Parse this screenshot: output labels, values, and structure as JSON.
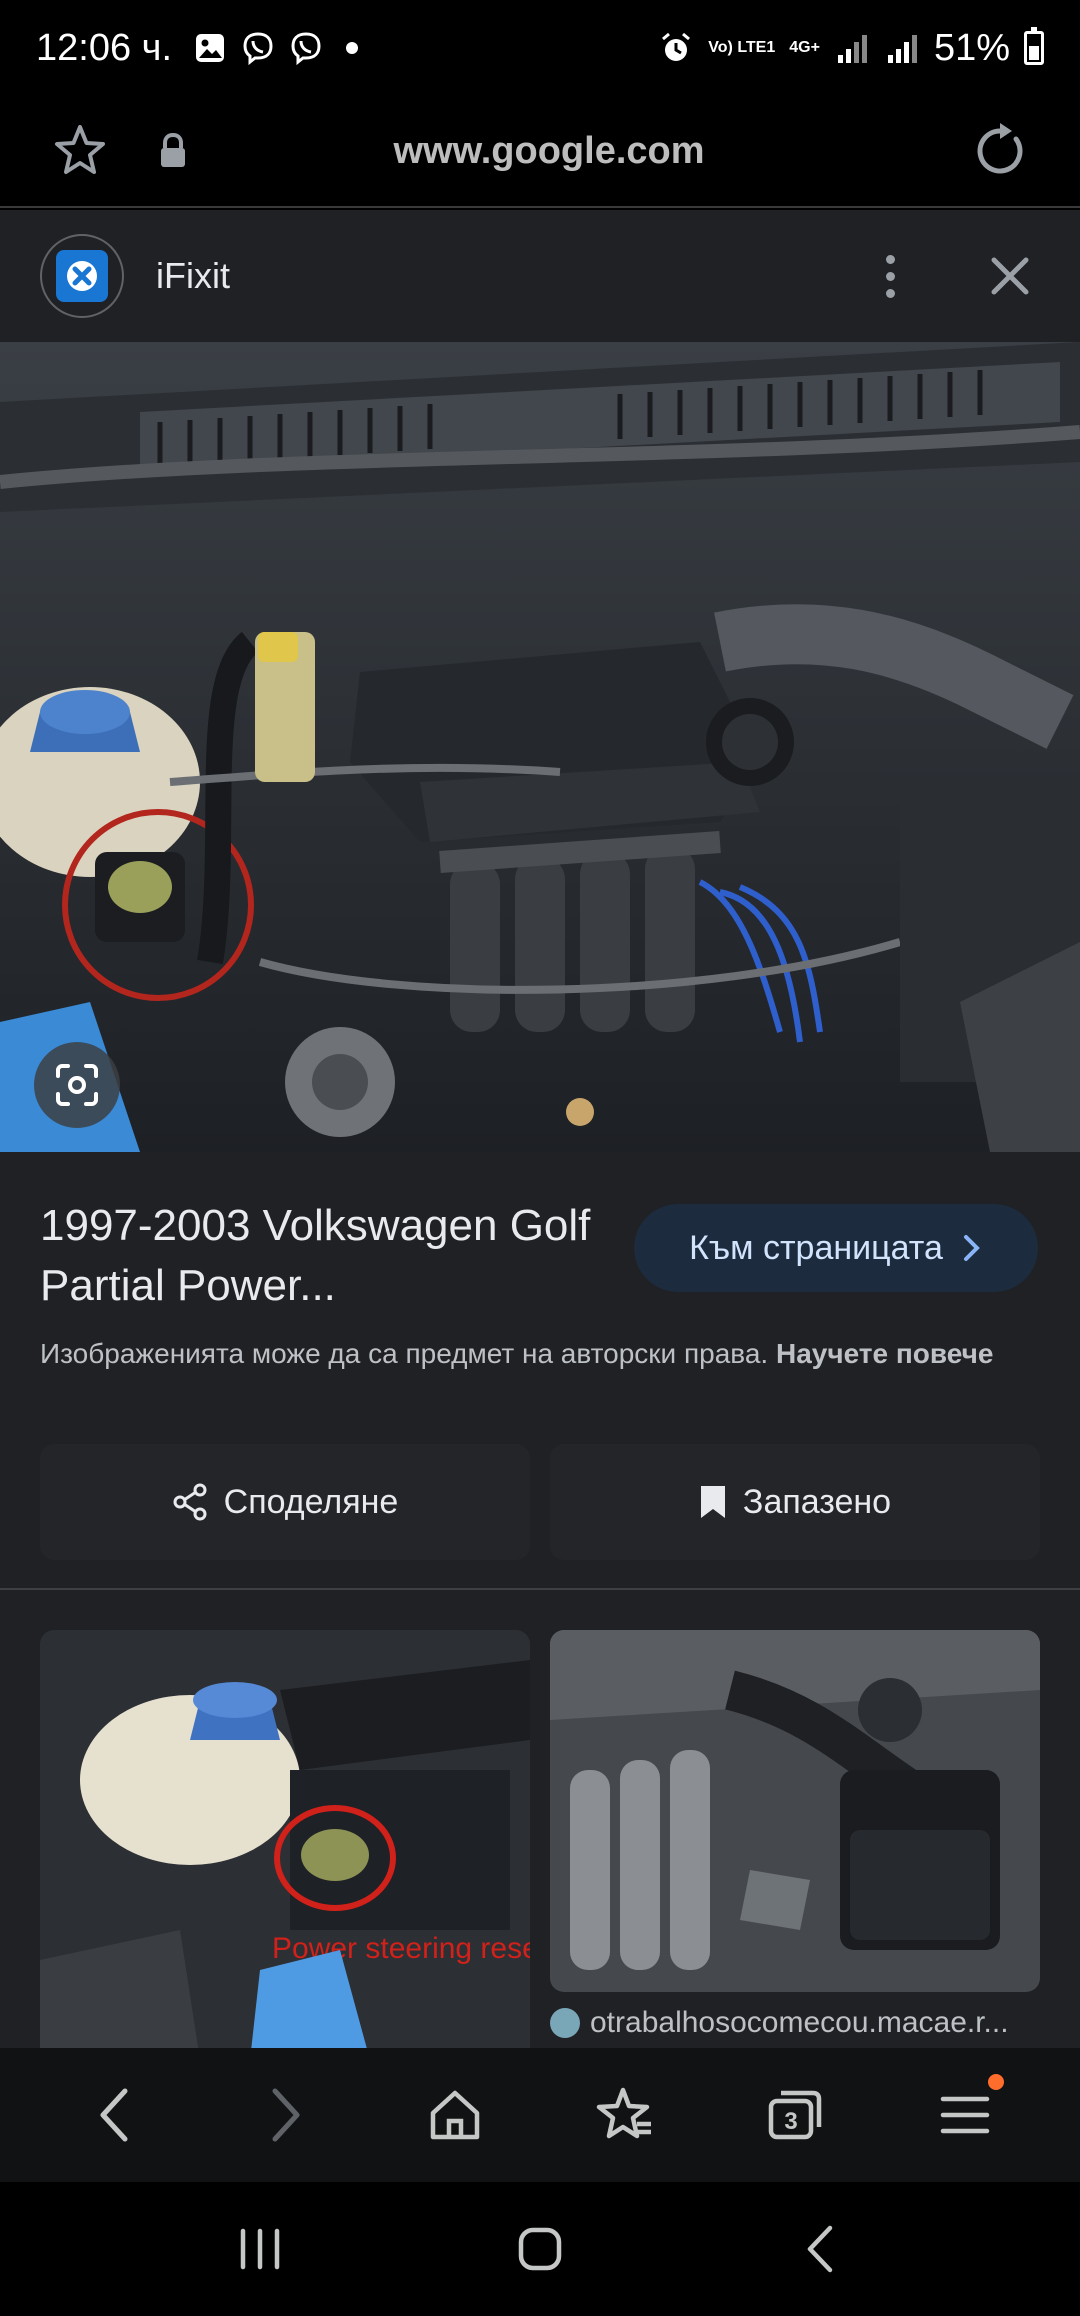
{
  "status_bar": {
    "time": "12:06 ч.",
    "left_icons": [
      "gallery-icon",
      "viber-icon",
      "viber-icon"
    ],
    "network_1": "Vo) LTE1",
    "network_2": "4G+",
    "battery": "51%",
    "battery_level": 0.51
  },
  "url_bar": {
    "url": "www.google.com"
  },
  "source": {
    "name": "iFixit"
  },
  "result": {
    "title": "1997-2003 Volkswagen Golf Partial Power...",
    "visit_label": "Към страницата",
    "copyright_text": "Изображенията може да са предмет на авторски права.",
    "learn_more": "Научете повече",
    "share_label": "Споделяне",
    "saved_label": "Запазено"
  },
  "related": {
    "thumb1_overlay_text": "Power steering reservoir",
    "thumb2_source": "otrabalhosocomecou.macae.r..."
  },
  "toolbar": {
    "tab_count": "3"
  },
  "colors": {
    "panel_bg": "#202124",
    "visit_button_bg": "#1c2b3d",
    "accent_dot": "#ff6d2d",
    "highlight_circle": "#b3261e"
  }
}
